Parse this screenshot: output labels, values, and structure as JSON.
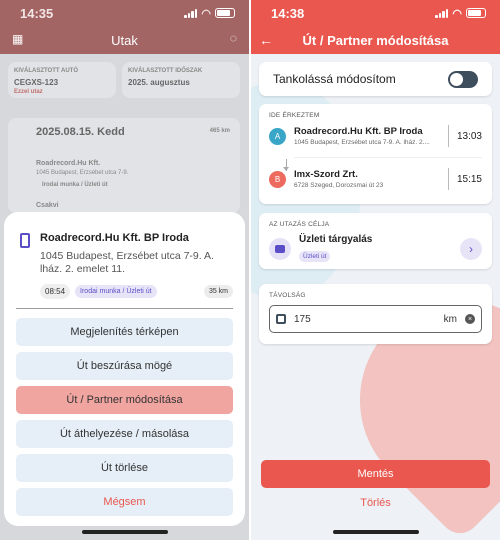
{
  "left": {
    "status_time": "14:35",
    "app_title": "Utak",
    "background": {
      "field1_label": "KIVÁLASZTOTT AUTÓ",
      "field1_value": "CEGXS-123",
      "field1_sub": "Ezzel utaz",
      "field2_label": "KIVÁLASZTOTT IDŐSZAK",
      "field2_value": "2025. augusztus",
      "date": "2025.08.15. Kedd",
      "km": "465 km",
      "item1": "Roadrecord.Hu Kft.",
      "item1_addr": "1045 Budapest, Erzsébet utca 7-9.",
      "item1_tag": "Irodai munka / Üzleti út",
      "item2": "Csakvi"
    },
    "sheet": {
      "title": "Roadrecord.Hu Kft. BP Iroda",
      "address": "1045 Budapest, Erzsébet utca 7-9. A. lház. 2. emelet 11.",
      "time": "08:54",
      "tag": "Irodai munka / Üzleti út",
      "distance": "35 km",
      "actions": [
        "Megjelenítés térképen",
        "Út beszúrása mögé",
        "Út / Partner módosítása",
        "Út áthelyezése / másolása",
        "Út törlése"
      ],
      "cancel": "Mégsem"
    }
  },
  "right": {
    "status_time": "14:38",
    "app_title": "Út / Partner módosítása",
    "toggle_label": "Tankolássá módosítom",
    "arrived_label": "IDE ÉRKEZTEM",
    "stop_a": {
      "marker": "A",
      "name": "Roadrecord.Hu Kft. BP Iroda",
      "address": "1045 Budapest, Erzsébet utca 7-9. A. lház. 2....",
      "time": "13:03"
    },
    "stop_b": {
      "marker": "B",
      "name": "Imx-Szord Zrt.",
      "address": "6728 Szeged, Dorozsmai út 23",
      "time": "15:15"
    },
    "purpose_label": "AZ UTAZÁS CÉLJA",
    "purpose_title": "Üzleti tárgyalás",
    "purpose_tag": "Üzleti út",
    "distance_label": "TÁVOLSÁG",
    "distance_value": "175",
    "distance_unit": "km",
    "save": "Mentés",
    "delete": "Törlés"
  },
  "colors": {
    "accent": "#e9574f",
    "purple": "#5b4fc7"
  }
}
